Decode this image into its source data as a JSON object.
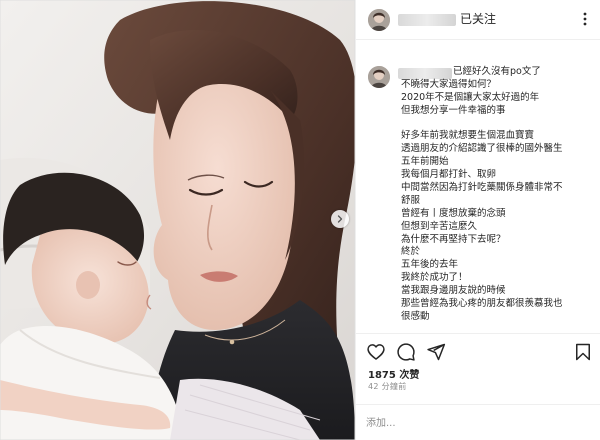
{
  "post": {
    "media": {
      "description_icon": "photo",
      "carousel_next_icon": "chevron-right-icon"
    },
    "header": {
      "follow_status": "已关注",
      "more_icon": "ellipsis-vertical-icon"
    },
    "caption": {
      "lines": [
        "已經好久沒有po文了",
        "不曉得大家過得如何？",
        "2020年不是個讓大家太好過的年",
        "但我想分享一件幸福的事",
        "",
        "好多年前我就想要生個混血寶寶",
        "透過朋友的介紹認識了很棒的國外醫生",
        "五年前開始",
        "我每個月都打針、取卵",
        "中間當然因為打針吃藥關係身體非常不",
        "舒服",
        "曾經有丨度想放棄的念頭",
        "但想到辛苦這麼久",
        "為什麼不再堅持下去呢？",
        "終於",
        "五年後的去年",
        "我終於成功了！",
        "當我跟身邊朋友說的時候",
        "那些曾經為我心疼的朋友都很羨慕我也",
        "很感動"
      ]
    },
    "actions": {
      "like_icon": "heart-icon",
      "comment_icon": "comment-icon",
      "share_icon": "send-icon",
      "save_icon": "bookmark-icon"
    },
    "likes": "1875 次赞",
    "timestamp": "42 分鐘前",
    "add_comment": {
      "placeholder": "添加...",
      "value": ""
    }
  }
}
